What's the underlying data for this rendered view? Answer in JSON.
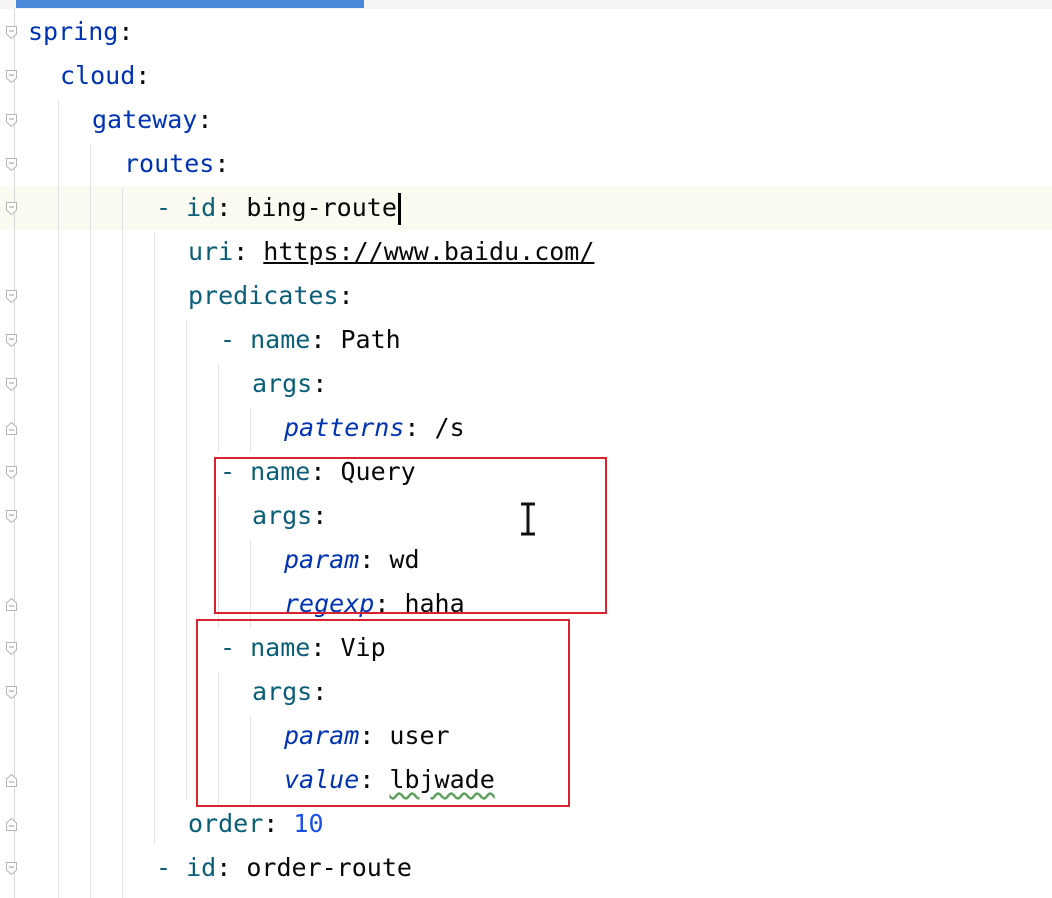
{
  "editor": {
    "colors": {
      "key": "#0033b3",
      "nested_key": "#0a5e78",
      "number": "#1750eb",
      "text": "#080808",
      "highlight_box": "#d9232e",
      "current_line": "#fbfbf2",
      "tab_indicator": "#4a88d8"
    },
    "lines": [
      {
        "key": "spring",
        "sep": ":"
      },
      {
        "key": "cloud",
        "sep": ":"
      },
      {
        "key": "gateway",
        "sep": ":"
      },
      {
        "key": "routes",
        "sep": ":"
      },
      {
        "dash": "-",
        "key": "id",
        "sep": ":",
        "value": "bing-route",
        "current": true
      },
      {
        "key": "uri",
        "sep": ":",
        "value": "https://www.baidu.com/"
      },
      {
        "key": "predicates",
        "sep": ":"
      },
      {
        "dash": "-",
        "key": "name",
        "sep": ":",
        "value": "Path"
      },
      {
        "key": "args",
        "sep": ":"
      },
      {
        "key": "patterns",
        "sep": ":",
        "value": "/s"
      },
      {
        "dash": "-",
        "key": "name",
        "sep": ":",
        "value": "Query"
      },
      {
        "key": "args",
        "sep": ":"
      },
      {
        "key": "param",
        "sep": ":",
        "value": "wd"
      },
      {
        "key": "regexp",
        "sep": ":",
        "value": "haha"
      },
      {
        "dash": "-",
        "key": "name",
        "sep": ":",
        "value": "Vip"
      },
      {
        "key": "args",
        "sep": ":"
      },
      {
        "key": "param",
        "sep": ":",
        "value": "user"
      },
      {
        "key": "value",
        "sep": ":",
        "value": "lbjwade"
      },
      {
        "key": "order",
        "sep": ":",
        "value": "10"
      },
      {
        "dash": "-",
        "key": "id",
        "sep": ":",
        "value": "order-route"
      }
    ]
  }
}
